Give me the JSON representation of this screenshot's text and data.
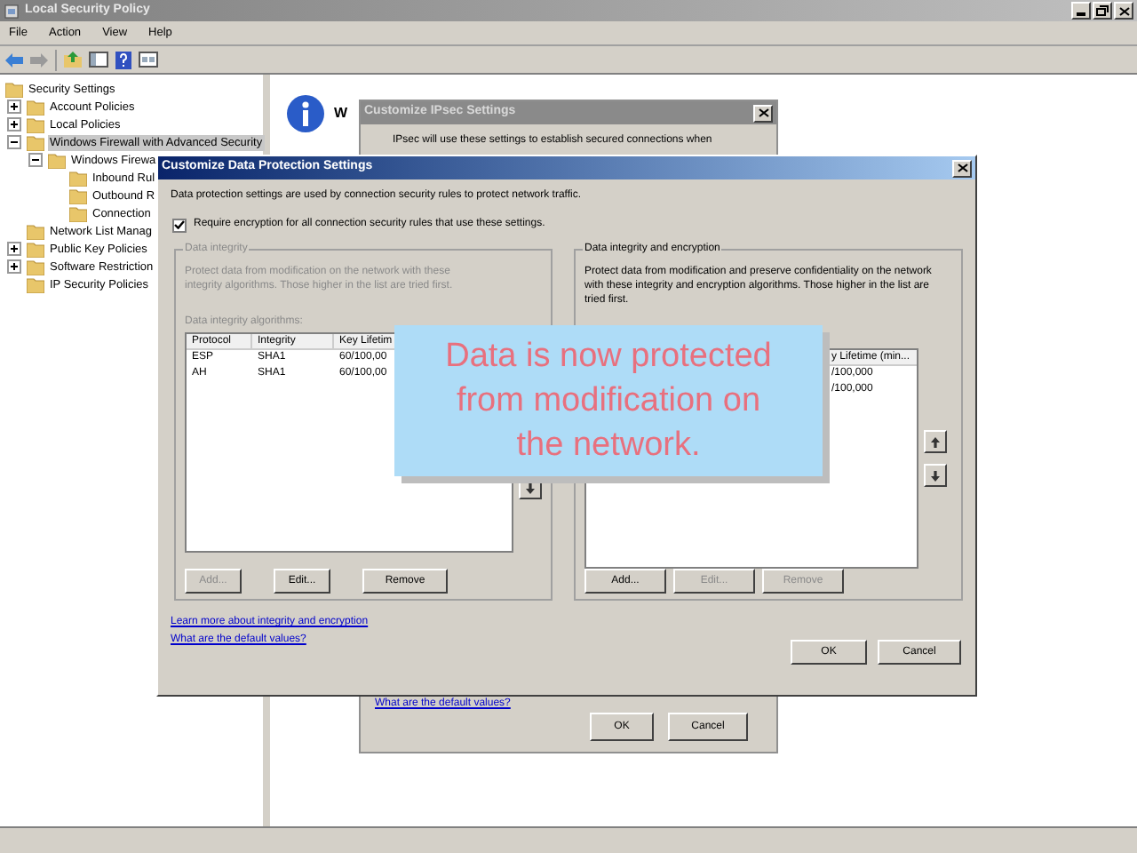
{
  "main_window": {
    "title": "Local Security Policy",
    "menu": [
      "File",
      "Action",
      "View",
      "Help"
    ],
    "tree": [
      {
        "label": "Security Settings",
        "selected": false,
        "children": [
          {
            "label": "Account Policies",
            "expanded": false,
            "selected": false
          },
          {
            "label": "Local Policies",
            "expanded": false,
            "selected": false
          },
          {
            "label": "Windows Firewall with Advanced Security",
            "expanded": true,
            "selected": true,
            "children": [
              {
                "label": "Windows Firewa",
                "expanded": true,
                "selected": false,
                "children": [
                  {
                    "label": "Inbound Rul",
                    "selected": false
                  },
                  {
                    "label": "Outbound R",
                    "selected": false
                  },
                  {
                    "label": "Connection",
                    "selected": false
                  }
                ]
              }
            ]
          },
          {
            "label": "Network List Manag",
            "selected": false
          },
          {
            "label": "Public Key Policies",
            "expanded": false,
            "selected": false
          },
          {
            "label": "Software Restriction",
            "expanded": false,
            "selected": false
          },
          {
            "label": "IP Security Policies",
            "selected": false
          }
        ]
      }
    ],
    "right_pane": {
      "heading": "W"
    }
  },
  "ipsec_dialog": {
    "title": "Customize IPsec Settings",
    "intro": "IPsec will use these settings to establish secured connections when",
    "link": "What are the default values?",
    "buttons": [
      "OK",
      "Cancel"
    ]
  },
  "dialog": {
    "title": "Customize Data Protection Settings",
    "intro": "Data protection settings are used by connection security rules to protect network traffic.",
    "require_encryption": {
      "label": "Require encryption for all connection security rules that use these settings.",
      "checked": true
    },
    "groups": [
      {
        "title": "Data integrity",
        "disabled": true,
        "description": "Protect data from modification on the network with these integrity algorithms. Those higher in the list are tried first.",
        "list_label": "Data integrity algorithms:",
        "columns": [
          "Protocol",
          "Integrity",
          "Key Lifetim"
        ],
        "rows": [
          [
            "ESP",
            "SHA1",
            "60/100,00"
          ],
          [
            "AH",
            "SHA1",
            "60/100,00"
          ]
        ],
        "buttons": [
          {
            "label": "Add...",
            "disabled": true
          },
          {
            "label": "Edit...",
            "disabled": false
          },
          {
            "label": "Remove",
            "disabled": false
          }
        ]
      },
      {
        "title": "Data integrity and encryption",
        "disabled": false,
        "description": "Protect data from modification and preserve confidentiality on the network with these integrity and encryption algorithms. Those higher in the list are tried first.",
        "columns": [
          "y Lifetime (min..."
        ],
        "rows": [
          [
            "/100,000"
          ],
          [
            "/100,000"
          ]
        ],
        "buttons": [
          {
            "label": "Add...",
            "disabled": false
          },
          {
            "label": "Edit...",
            "disabled": true
          },
          {
            "label": "Remove",
            "disabled": true
          }
        ]
      }
    ],
    "links": [
      "Learn more about integrity and encryption",
      "What are the default values?"
    ],
    "buttons": [
      "OK",
      "Cancel"
    ]
  },
  "callout": {
    "lines": [
      "Data is now protected",
      "from modification on",
      "the network."
    ]
  }
}
